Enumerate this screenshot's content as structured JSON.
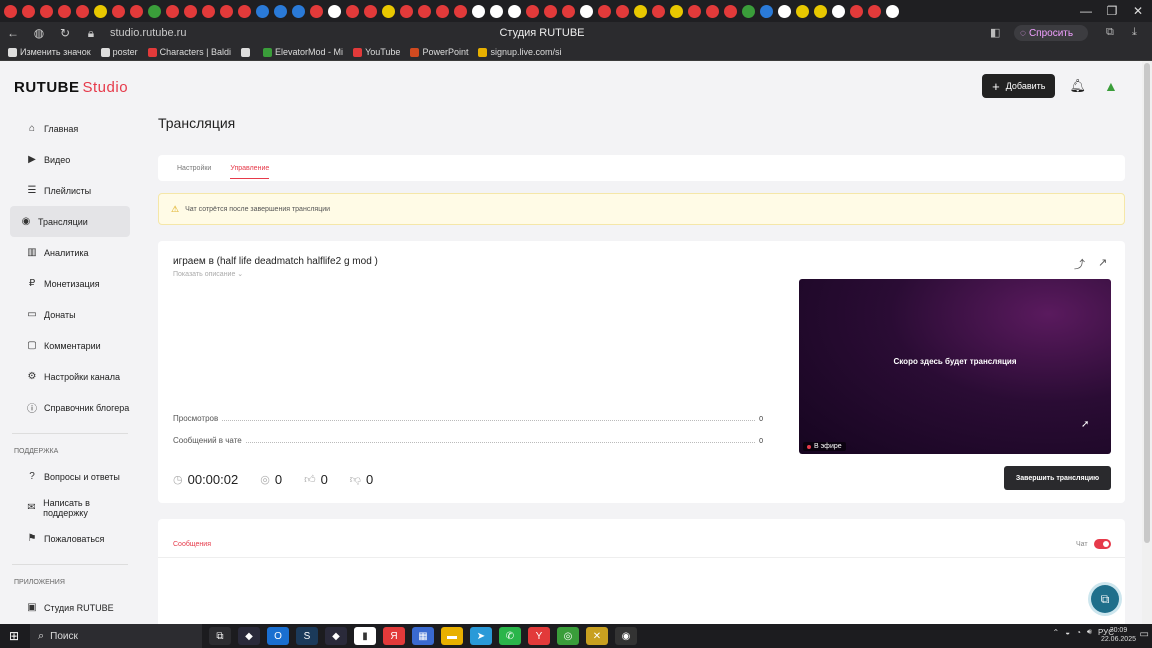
{
  "browser": {
    "title": "Студия RUTUBE",
    "url": "studio.rutube.ru",
    "ask_label": "Спросить",
    "tab_icon_colors": [
      "#e23a3a",
      "#e23a3a",
      "#e23a3a",
      "#e23a3a",
      "#e23a3a",
      "#e8c800",
      "#e23a3a",
      "#e23a3a",
      "#3a9d3a",
      "#e23a3a",
      "#e23a3a",
      "#e23a3a",
      "#e23a3a",
      "#e23a3a",
      "#2a7ad8",
      "#2a7ad8",
      "#2a7ad8",
      "#e23a3a",
      "#ffffff",
      "#e23a3a",
      "#e23a3a",
      "#e8c800",
      "#e23a3a",
      "#e23a3a",
      "#e23a3a",
      "#e23a3a",
      "#ffffff",
      "#ffffff",
      "#ffffff",
      "#e23a3a",
      "#e23a3a",
      "#e23a3a",
      "#ffffff",
      "#e23a3a",
      "#e23a3a",
      "#e8c800",
      "#e23a3a",
      "#e8c800",
      "#e23a3a",
      "#e23a3a",
      "#e23a3a",
      "#3a9d3a",
      "#2a7ad8",
      "#ffffff",
      "#e8c800",
      "#e8c800",
      "#ffffff",
      "#e23a3a",
      "#e23a3a",
      "#ffffff"
    ],
    "bookmarks": [
      {
        "label": "Изменить значок",
        "color": "#dddddd"
      },
      {
        "label": "poster",
        "color": "#dddddd"
      },
      {
        "label": "Characters | Baldi",
        "color": "#e23a3a"
      },
      {
        "label": "",
        "color": "#dddddd"
      },
      {
        "label": "ElevatorMod - Mi",
        "color": "#3a9d3a"
      },
      {
        "label": "YouTube",
        "color": "#e23a3a"
      },
      {
        "label": "PowerPoint",
        "color": "#d04a20"
      },
      {
        "label": "signup.live.com/si",
        "color": "#e8b000"
      }
    ]
  },
  "brand": {
    "name": "RUTUBE",
    "suffix": "Studio"
  },
  "header": {
    "add_label": "Добавить"
  },
  "sidebar": {
    "items": [
      {
        "label": "Главная",
        "icon": "home-icon",
        "glyph": "⌂"
      },
      {
        "label": "Видео",
        "icon": "video-icon",
        "glyph": "▶"
      },
      {
        "label": "Плейлисты",
        "icon": "playlist-icon",
        "glyph": "☰"
      },
      {
        "label": "Трансляции",
        "icon": "broadcast-icon",
        "glyph": "◉"
      },
      {
        "label": "Аналитика",
        "icon": "analytics-icon",
        "glyph": "▥"
      },
      {
        "label": "Монетизация",
        "icon": "monetization-icon",
        "glyph": "₽"
      },
      {
        "label": "Донаты",
        "icon": "donate-icon",
        "glyph": "▭"
      },
      {
        "label": "Комментарии",
        "icon": "comments-icon",
        "glyph": "▢"
      },
      {
        "label": "Настройки канала",
        "icon": "gear-icon",
        "glyph": "⚙"
      },
      {
        "label": "Справочник блогера",
        "icon": "info-icon",
        "glyph": "ⓘ"
      }
    ],
    "support_title": "ПОДДЕРЖКА",
    "support_items": [
      {
        "label": "Вопросы и ответы",
        "icon": "question-icon",
        "glyph": "?"
      },
      {
        "label": "Написать в поддержку",
        "icon": "mail-icon",
        "glyph": "✉"
      },
      {
        "label": "Пожаловаться",
        "icon": "flag-icon",
        "glyph": "⚑"
      }
    ],
    "apps_title": "ПРИЛОЖЕНИЯ",
    "apps_items": [
      {
        "label": "Студия RUTUBE",
        "icon": "studio-app-icon",
        "glyph": "▣"
      }
    ]
  },
  "page": {
    "title": "Трансляция",
    "tabs": [
      "Настройки",
      "Управление"
    ],
    "notice": "Чат сотрётся после завершения трансляции"
  },
  "stream": {
    "title": "играем в (half life deadmatch halflife2 g mod )",
    "show_description": "Показать описание ⌄",
    "stats": [
      {
        "label": "Просмотров",
        "value": "0"
      },
      {
        "label": "Сообщений в чате",
        "value": "0"
      }
    ],
    "player_text": "Скоро здесь будет трансляция",
    "live_label": "В эфире",
    "duration": "00:00:02",
    "viewers": "0",
    "likes": "0",
    "dislikes": "0",
    "end_label": "Завершить трансляцию"
  },
  "chat": {
    "tab_label": "Сообщения",
    "toggle_label": "Чат"
  },
  "taskbar": {
    "search_label": "Поиск",
    "apps": [
      {
        "name": "task-view-icon",
        "color": "#2c2c30",
        "glyph": "⧉"
      },
      {
        "name": "app-icon",
        "color": "#2a2a3a",
        "glyph": "◆"
      },
      {
        "name": "outlook-icon",
        "color": "#1a6fd0",
        "glyph": "O"
      },
      {
        "name": "steam-icon",
        "color": "#1b3a5a",
        "glyph": "S"
      },
      {
        "name": "app-icon",
        "color": "#2a2a3a",
        "glyph": "◆"
      },
      {
        "name": "file-icon",
        "color": "#ffffff",
        "glyph": "▮"
      },
      {
        "name": "yandex-icon",
        "color": "#e23a3a",
        "glyph": "Я"
      },
      {
        "name": "calc-icon",
        "color": "#3a6ad0",
        "glyph": "▦"
      },
      {
        "name": "folder-icon",
        "color": "#e8b000",
        "glyph": "▬"
      },
      {
        "name": "telegram-icon",
        "color": "#2a9ad8",
        "glyph": "➤"
      },
      {
        "name": "whatsapp-icon",
        "color": "#2ab54a",
        "glyph": "✆"
      },
      {
        "name": "yandex-browser-icon",
        "color": "#e23a3a",
        "glyph": "Y"
      },
      {
        "name": "chrome-icon",
        "color": "#3a9d3a",
        "glyph": "◎"
      },
      {
        "name": "app-icon",
        "color": "#c8a020",
        "glyph": "✕"
      },
      {
        "name": "obs-icon",
        "color": "#333333",
        "glyph": "◉"
      }
    ],
    "lang": "РУС",
    "time": "20:09",
    "date": "22.06.2025"
  },
  "colors": {
    "accent": "#e63a4a",
    "dark_button": "#2a2a2d",
    "notice_bg": "#fffbe6"
  }
}
